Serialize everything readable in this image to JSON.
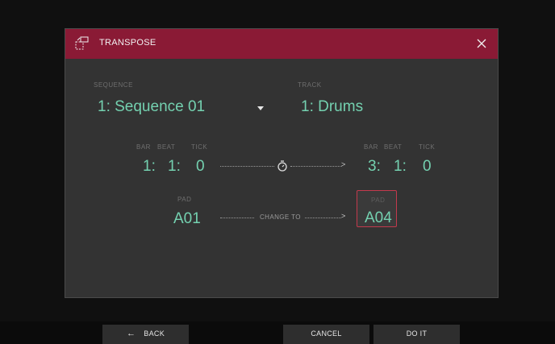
{
  "dialog": {
    "title": "TRANSPOSE",
    "sequence": {
      "label": "SEQUENCE",
      "value": "1: Sequence 01"
    },
    "track": {
      "label": "TRACK",
      "value": "1: Drums"
    },
    "from_time": {
      "labels": [
        "BAR",
        "BEAT",
        "TICK"
      ],
      "bar": "1:",
      "beat": "1:",
      "tick": "0"
    },
    "to_time": {
      "labels": [
        "BAR",
        "BEAT",
        "TICK"
      ],
      "bar": "3:",
      "beat": "1:",
      "tick": "0"
    },
    "from_pad": {
      "label": "PAD",
      "value": "A01"
    },
    "change_to": "CHANGE TO",
    "to_pad": {
      "label": "PAD",
      "value": "A04"
    }
  },
  "buttons": {
    "back": "BACK",
    "cancel": "CANCEL",
    "do_it": "DO IT"
  },
  "colors": {
    "header": "#8a1a35",
    "value_text": "#74d1b0",
    "highlight_border": "#c43a4d"
  },
  "icons": {
    "header": "transpose-icon",
    "close": "close-icon",
    "timer": "stopwatch-icon",
    "back": "arrow-left-icon",
    "dropdown": "caret-down-icon"
  }
}
